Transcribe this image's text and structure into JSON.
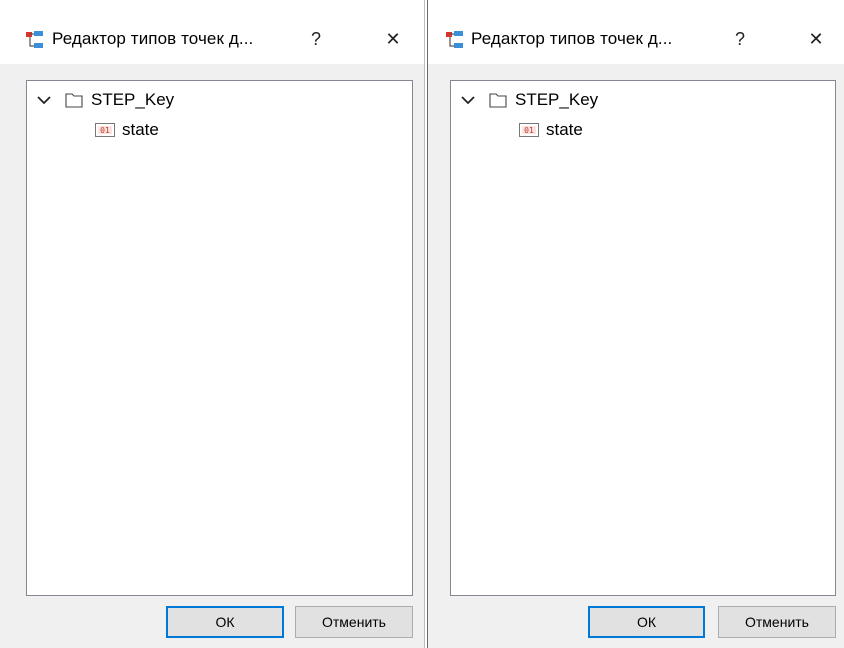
{
  "dialogs": [
    {
      "title": "Редактор типов точек д...",
      "help_label": "?",
      "close_label": "✕",
      "tree": {
        "folder": "STEP_Key",
        "items": [
          {
            "label": "state",
            "icon": "bool-01-icon"
          }
        ]
      },
      "ok_label": "ОК",
      "cancel_label": "Отменить"
    },
    {
      "title": "Редактор типов точек д...",
      "help_label": "?",
      "close_label": "✕",
      "tree": {
        "folder": "STEP_Key",
        "items": [
          {
            "label": "state",
            "icon": "bool-01-icon"
          }
        ]
      },
      "ok_label": "ОК",
      "cancel_label": "Отменить"
    }
  ],
  "colors": {
    "accent": "#0078d7",
    "dialog_bg": "#f0f0f0",
    "border": "#828790"
  }
}
